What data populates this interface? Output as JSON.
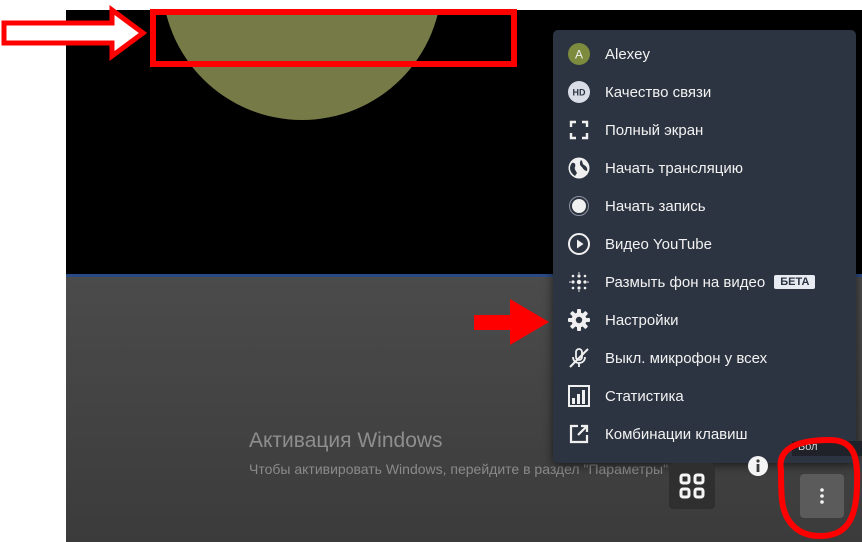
{
  "watermark": {
    "title": "Активация Windows",
    "subtitle": "Чтобы активировать Windows, перейдите в раздел \"Параметры\"."
  },
  "menu": {
    "items": [
      {
        "label": "Alexey",
        "icon": "user-avatar-icon",
        "avatar_letter": "A"
      },
      {
        "label": "Качество связи",
        "icon": "quality-hd-icon",
        "badge_text": "HD"
      },
      {
        "label": "Полный экран",
        "icon": "fullscreen-icon"
      },
      {
        "label": "Начать трансляцию",
        "icon": "globe-icon"
      },
      {
        "label": "Начать запись",
        "icon": "record-icon"
      },
      {
        "label": "Видео YouTube",
        "icon": "play-icon"
      },
      {
        "label": "Размыть фон на видео",
        "icon": "blur-icon",
        "tag": "БЕТА"
      },
      {
        "label": "Настройки",
        "icon": "gear-icon"
      },
      {
        "label": "Выкл. микрофон у всех",
        "icon": "mute-mic-icon"
      },
      {
        "label": "Статистика",
        "icon": "stats-icon"
      },
      {
        "label": "Комбинации клавиш",
        "icon": "external-link-icon"
      }
    ]
  },
  "controls": {
    "grid": "grid-view-icon",
    "info": "info-icon",
    "more": "more-vertical-icon",
    "tooltip": "Бол"
  },
  "colors": {
    "menu_bg": "#2d3441",
    "avatar_olive": "#767a46",
    "annotation_red": "#ff0000"
  }
}
